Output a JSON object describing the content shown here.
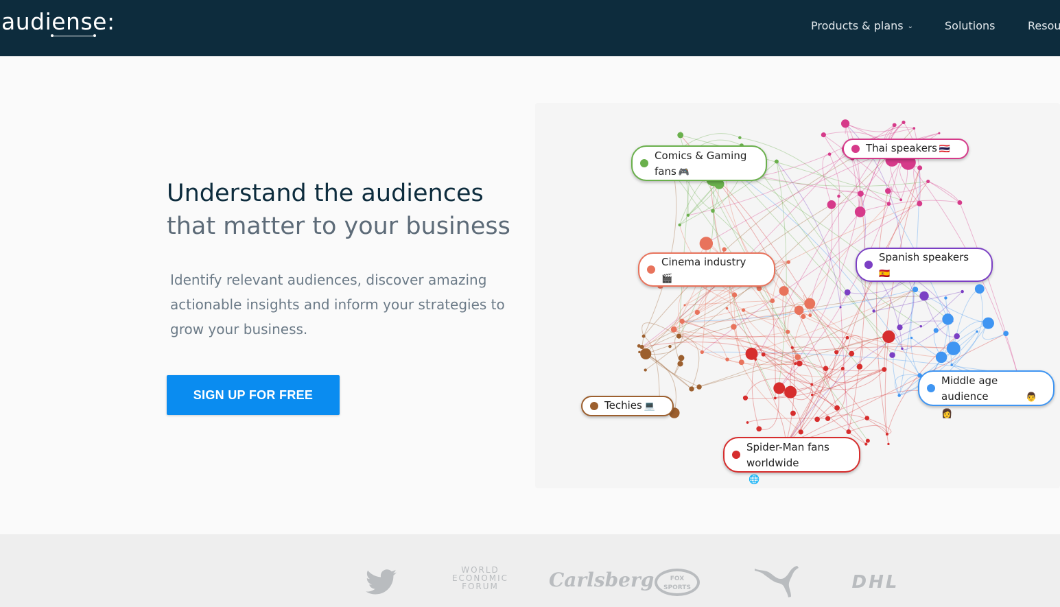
{
  "header": {
    "logo_text": "audiense:",
    "nav": [
      {
        "label": "Products & plans",
        "has_dropdown": true
      },
      {
        "label": "Solutions",
        "has_dropdown": false
      },
      {
        "label": "Resou",
        "has_dropdown": false
      }
    ]
  },
  "hero": {
    "title": "Understand the audiences",
    "subtitle": "that matter to your business",
    "description": "Identify relevant audiences, discover amazing actionable insights and inform your strategies to grow your business.",
    "cta_label": "SIGN UP FOR FREE"
  },
  "network": {
    "clusters": [
      {
        "label": "Comics & Gaming fans",
        "emoji": "🎮",
        "color": "#6ab04c"
      },
      {
        "label": "Thai speakers",
        "emoji": "🇹🇭",
        "color": "#d63a8a"
      },
      {
        "label": "Cinema industry",
        "emoji": "🎬",
        "color": "#e8735c"
      },
      {
        "label": "Spanish speakers",
        "emoji": "🇪🇸",
        "color": "#7b3fc4"
      },
      {
        "label": "Techies",
        "emoji": "💻",
        "color": "#9c5f2e"
      },
      {
        "label": "Middle age audience",
        "emoji": "👨 👩",
        "color": "#3f95f2"
      },
      {
        "label": "Spider-Man fans worldwide",
        "emoji": "🌐",
        "color": "#d62d2d"
      }
    ]
  },
  "logos": [
    {
      "name": "twitter",
      "text": ""
    },
    {
      "name": "world-economic-forum",
      "text": "WORLD ECONOMIC FORUM"
    },
    {
      "name": "carlsberg",
      "text": "Carlsberg"
    },
    {
      "name": "fox-sports",
      "text": "FOX SPORTS"
    },
    {
      "name": "puma",
      "text": ""
    },
    {
      "name": "dhl",
      "text": "DHL"
    }
  ]
}
